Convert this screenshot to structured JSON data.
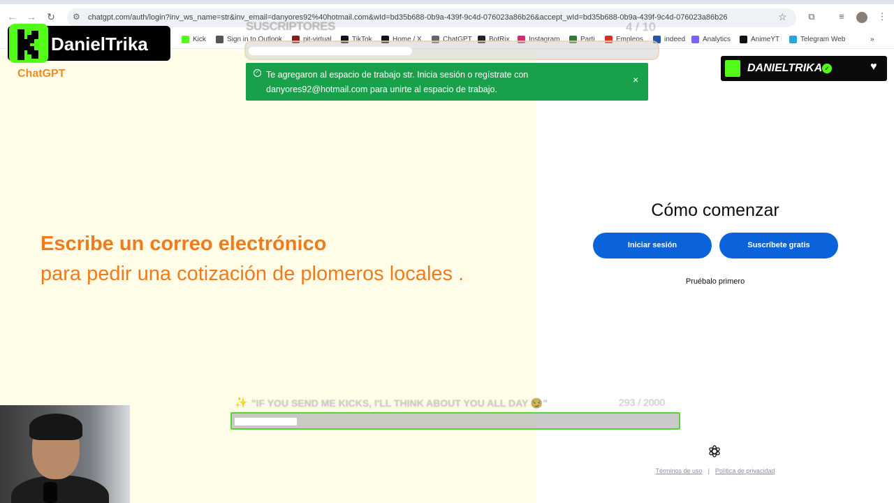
{
  "browser": {
    "url": "chatgpt.com/auth/login?inv_ws_name=str&inv_email=danyores92%40hotmail.com&wId=bd35b688-0b9a-439f-9c4d-076023a86b26&accept_wId=bd35b688-0b9a-439f-9c4d-076023a86b26",
    "bookmarks": [
      {
        "label": "Kick",
        "color": "#53fc18"
      },
      {
        "label": "Sign in to Outlook",
        "color": "#555555"
      },
      {
        "label": "pit-virtual",
        "color": "#8b1a1a"
      },
      {
        "label": "TikTok",
        "color": "#111111"
      },
      {
        "label": "Home / X",
        "color": "#111111"
      },
      {
        "label": "ChatGPT",
        "color": "#666666"
      },
      {
        "label": "BotRix",
        "color": "#222222"
      },
      {
        "label": "Instagram",
        "color": "#d62976"
      },
      {
        "label": "Parti",
        "color": "#2f7a3a"
      },
      {
        "label": "Empleos",
        "color": "#d93025"
      },
      {
        "label": "indeed",
        "color": "#2557a7"
      },
      {
        "label": "Analytics",
        "color": "#7b61ff"
      },
      {
        "label": "AnimeYT",
        "color": "#111111"
      },
      {
        "label": "Telegram Web",
        "color": "#2aa3df"
      }
    ],
    "more_label": "»"
  },
  "page": {
    "brand": "ChatGPT",
    "headline": "Escribe un correo electrónico",
    "subline": "para pedir una cotización de plomeros locales .",
    "how_title": "Cómo comenzar",
    "login_button": "Iniciar sesión",
    "signup_button": "Suscríbete gratis",
    "try_first": "Pruébalo primero",
    "terms": "Términos de uso",
    "separator": "|",
    "privacy": "Política de privacidad"
  },
  "toast": {
    "message": "Te agregaron al espacio de trabajo str. Inicia sesión o regístrate con danyores92@hotmail.com para unirte al espacio de trabajo.",
    "close": "×"
  },
  "overlays": {
    "sub_goal": {
      "label": "SUSCRIPTORES",
      "count": "4  / 10",
      "progress": 0.4
    },
    "streamer_logo": "DanielTrika",
    "kick_badge": {
      "name": "DANIELTRIKA",
      "verified": "✓",
      "heart": "♥"
    },
    "kick_goal": {
      "icon": "✨",
      "text": "\"IF YOU SEND ME KICKS, I'LL THINK ABOUT YOU ALL DAY 😏\"",
      "count": "293  / 2000",
      "progress": 0.1465
    }
  },
  "colors": {
    "left_bg": "#fffde7",
    "accent_orange": "#f07b1d",
    "button_blue": "#0a63d8",
    "toast_green": "#19a04b",
    "kick_green": "#53fc18"
  }
}
